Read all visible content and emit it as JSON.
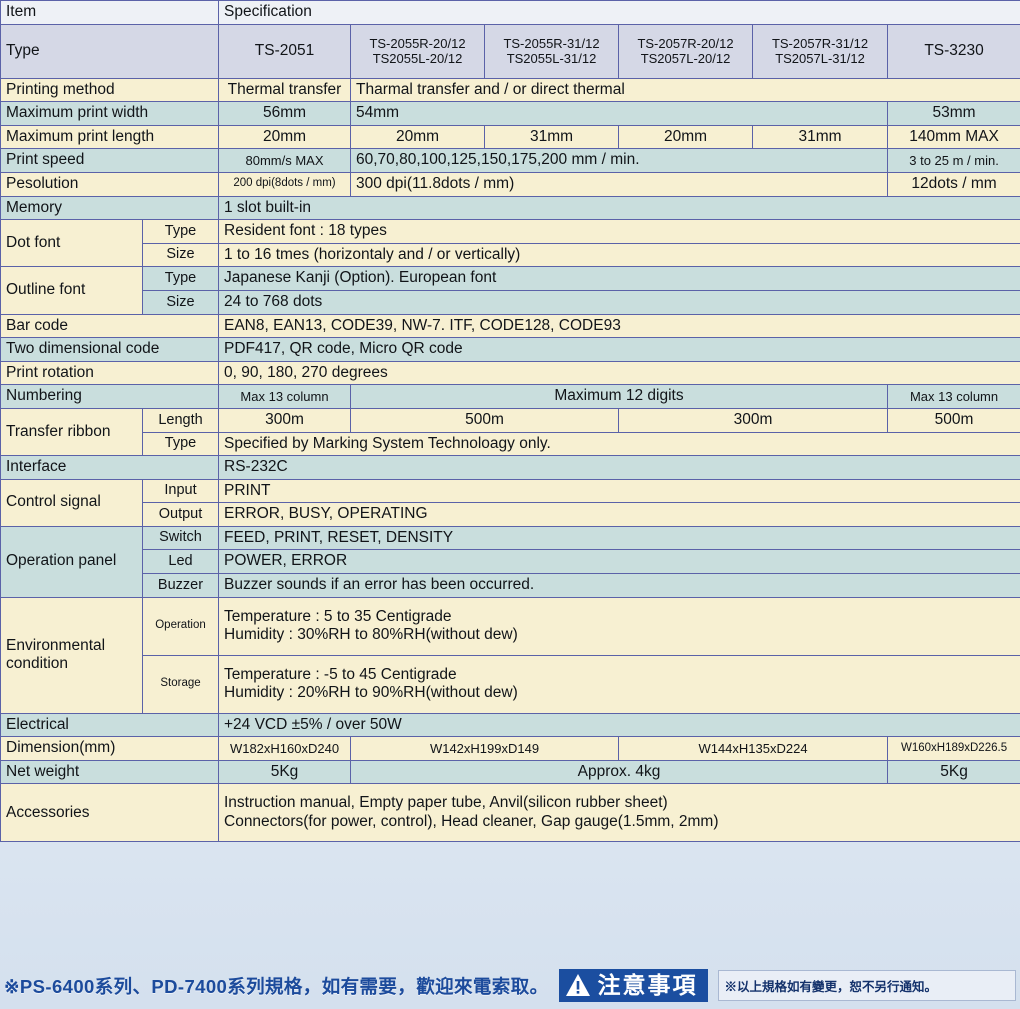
{
  "table": {
    "header": {
      "item_label": "Item",
      "spec_label": "Specification",
      "type_label": "Type",
      "models": [
        {
          "line1": "TS-2051",
          "line2": ""
        },
        {
          "line1": "TS-2055R-20/12",
          "line2": "TS2055L-20/12"
        },
        {
          "line1": "TS-2055R-31/12",
          "line2": "TS2055L-31/12"
        },
        {
          "line1": "TS-2057R-20/12",
          "line2": "TS2057L-20/12"
        },
        {
          "line1": "TS-2057R-31/12",
          "line2": "TS2057L-31/12"
        },
        {
          "line1": "TS-3230",
          "line2": ""
        }
      ]
    },
    "rows": {
      "printing_method": {
        "label": "Printing method",
        "v1": "Thermal transfer",
        "v2": "Tharmal transfer and / or direct thermal"
      },
      "max_print_width": {
        "label": "Maximum print width",
        "v1": "56mm",
        "v2": "54mm",
        "v6": "53mm"
      },
      "max_print_length": {
        "label": "Maximum print length",
        "v1": "20mm",
        "v2": "20mm",
        "v3": "31mm",
        "v4": "20mm",
        "v5": "31mm",
        "v6": "140mm MAX"
      },
      "print_speed": {
        "label": "Print speed",
        "v1": "80mm/s MAX",
        "v2": "60,70,80,100,125,150,175,200 mm / min.",
        "v6": "3 to 25 m / min."
      },
      "resolution": {
        "label": "Pesolution",
        "v1": "200 dpi(8dots / mm)",
        "v2": "300 dpi(11.8dots / mm)",
        "v6": "12dots / mm"
      },
      "memory": {
        "label": "Memory",
        "value": "1 slot built-in"
      },
      "dot_font": {
        "label": "Dot font",
        "sub_type": "Type",
        "type_value": "Resident font : 18 types",
        "sub_size": "Size",
        "size_value": "1 to 16 tmes (horizontaly and / or vertically)"
      },
      "outline_font": {
        "label": "Outline font",
        "sub_type": "Type",
        "type_value": "Japanese Kanji (Option). European font",
        "sub_size": "Size",
        "size_value": "24 to 768 dots"
      },
      "bar_code": {
        "label": "Bar code",
        "value": "EAN8, EAN13, CODE39, NW-7. ITF, CODE128, CODE93"
      },
      "two_dimensional_code": {
        "label": "Two dimensional code",
        "value": "PDF417, QR code, Micro QR code"
      },
      "print_rotation": {
        "label": "Print rotation",
        "value": "0, 90, 180, 270 degrees"
      },
      "numbering": {
        "label": "Numbering",
        "v1": "Max 13 column",
        "v2": "Maximum 12 digits",
        "v6": "Max 13 column"
      },
      "transfer_ribbon": {
        "label": "Transfer ribbon",
        "sub_length": "Length",
        "length_v1": "300m",
        "length_v2": "500m",
        "length_v4": "300m",
        "length_v6": "500m",
        "sub_type": "Type",
        "type_value": "Specified by Marking System Technoloagy only."
      },
      "interface": {
        "label": "Interface",
        "value": "RS-232C"
      },
      "control_signal": {
        "label": "Control signal",
        "sub_input": "Input",
        "input_value": "PRINT",
        "sub_output": "Output",
        "output_value": "ERROR, BUSY, OPERATING"
      },
      "operation_panel": {
        "label": "Operation panel",
        "sub_switch": "Switch",
        "switch_value": "FEED, PRINT, RESET, DENSITY",
        "sub_led": "Led",
        "led_value": "POWER, ERROR",
        "sub_buzzer": "Buzzer",
        "buzzer_value": "Buzzer sounds if an error has been occurred."
      },
      "environmental_condition": {
        "label_line1": "Environmental",
        "label_line2": "condition",
        "sub_operation": "Operation",
        "operation_line1": "Temperature : 5 to 35 Centigrade",
        "operation_line2": "Humidity : 30%RH to 80%RH(without dew)",
        "sub_storage": "Storage",
        "storage_line1": "Temperature : -5 to 45 Centigrade",
        "storage_line2": "Humidity : 20%RH to 90%RH(without dew)"
      },
      "electrical": {
        "label": "Electrical",
        "value": "+24 VCD ±5% / over 50W"
      },
      "dimension": {
        "label": "Dimension(mm)",
        "v1": "W182xH160xD240",
        "v2": "W142xH199xD149",
        "v4": "W144xH135xD224",
        "v6": "W160xH189xD226.5"
      },
      "net_weight": {
        "label": "Net weight",
        "v1": "5Kg",
        "v2": "Approx. 4kg",
        "v6": "5Kg"
      },
      "accessories": {
        "label": "Accessories",
        "line1": "Instruction manual, Empty paper tube, Anvil(silicon rubber sheet)",
        "line2": "Connectors(for power, control), Head cleaner, Gap gauge(1.5mm, 2mm)"
      }
    }
  },
  "footer": {
    "note": "※PS-6400系列、PD-7400系列規格，如有需要，歡迎來電索取。",
    "badge_text": "注意事項",
    "disclaimer": "※以上規格如有變更，恕不另行通知。"
  },
  "colors": {
    "grid_line": "#5b62a8",
    "row_cream": "#f7f0d2",
    "row_teal": "#c9dedd",
    "type_header": "#d5d8e6",
    "badge_blue": "#1b4ea0",
    "footer_text": "#1c4b9c"
  }
}
